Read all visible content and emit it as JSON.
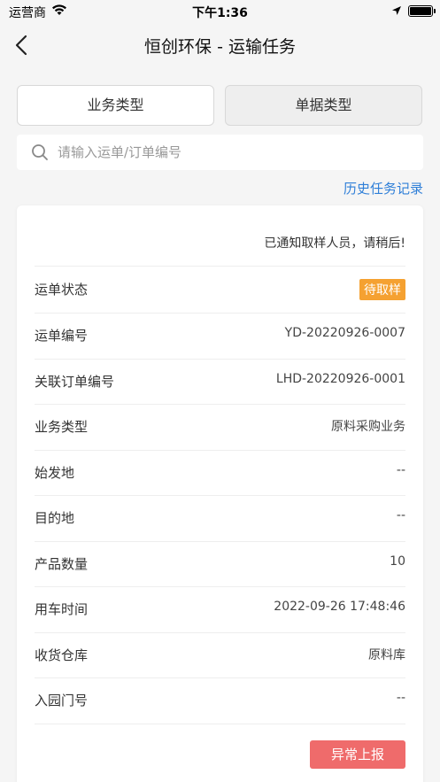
{
  "status_bar": {
    "carrier": "运营商",
    "time": "下午1:36"
  },
  "nav": {
    "title": "恒创环保 - 运输任务"
  },
  "filters": {
    "business_type_label": "业务类型",
    "document_type_label": "单据类型"
  },
  "search": {
    "placeholder": "请输入运单/订单编号"
  },
  "history_link": "历史任务记录",
  "card": {
    "notice": "已通知取样人员，请稍后!",
    "rows": [
      {
        "label": "运单状态",
        "value": "待取样"
      },
      {
        "label": "运单编号",
        "value": "YD-20220926-0007"
      },
      {
        "label": "关联订单编号",
        "value": "LHD-20220926-0001"
      },
      {
        "label": "业务类型",
        "value": "原料采购业务"
      },
      {
        "label": "始发地",
        "value": "--"
      },
      {
        "label": "目的地",
        "value": "--"
      },
      {
        "label": "产品数量",
        "value": "10"
      },
      {
        "label": "用车时间",
        "value": "2022-09-26 17:48:46"
      },
      {
        "label": "收货仓库",
        "value": "原料库"
      },
      {
        "label": "入园门号",
        "value": "--"
      }
    ],
    "report_button": "异常上报"
  },
  "colors": {
    "badge": "#f5a131",
    "report_button": "#ef6b6b",
    "link": "#2f7fd8"
  }
}
